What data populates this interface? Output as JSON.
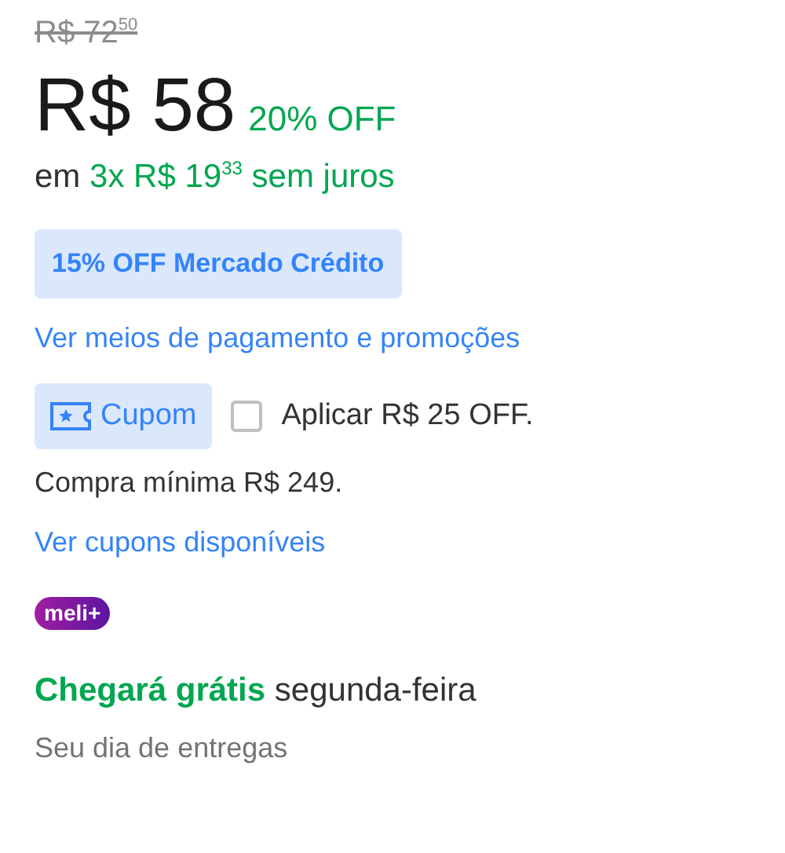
{
  "original_price": "R$ 72$^{50}$",
  "price": "R$ 58",
  "discount": "20% OFF",
  "installments": {
    "prefix": "em",
    "highlight": "3x R$ 19$^{33}$ sem juros"
  },
  "credit_badge": "15% OFF Mercado Crédito",
  "payment_link": "Ver meios de pagamento e promoções",
  "coupon": {
    "label": "Cupom",
    "checked": false,
    "apply": "Aplicar R$ 25 OFF.",
    "minimum": "Compra mínima R$ 249.",
    "link": "Ver cupons disponíveis"
  },
  "meli_badge": "meli+",
  "delivery": {
    "highlight": "Chegará grátis",
    "day": "segunda-feira",
    "note": "Seu dia de entregas"
  }
}
